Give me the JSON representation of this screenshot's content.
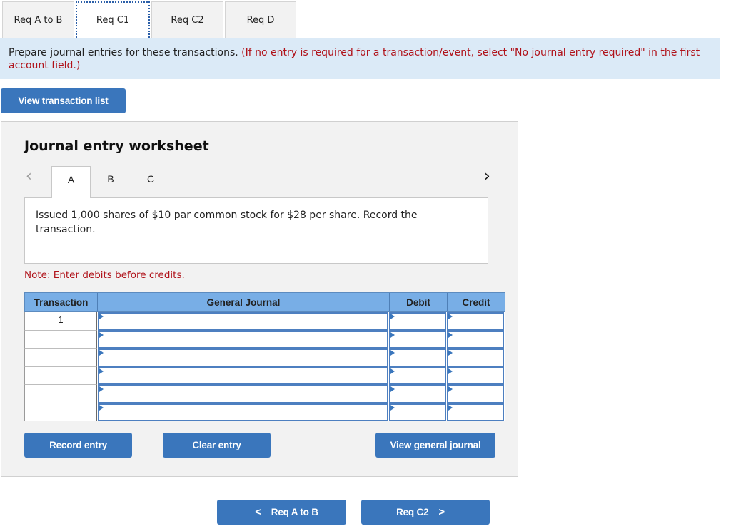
{
  "req_tabs": [
    {
      "label": "Req A to B",
      "active": false
    },
    {
      "label": "Req C1",
      "active": true
    },
    {
      "label": "Req C2",
      "active": false
    },
    {
      "label": "Req D",
      "active": false
    }
  ],
  "instruction": {
    "main": "Prepare journal entries for these transactions. ",
    "note": "(If no entry is required for a transaction/event, select \"No journal entry required\" in the first account field.)"
  },
  "view_transaction_list_label": "View transaction list",
  "worksheet": {
    "title": "Journal entry worksheet",
    "prev_icon": "chevron-left-icon",
    "next_icon": "chevron-right-icon",
    "sub_tabs": [
      {
        "label": "A",
        "active": true
      },
      {
        "label": "B",
        "active": false
      },
      {
        "label": "C",
        "active": false
      }
    ],
    "description": "Issued 1,000 shares of $10 par common stock for $28 per share. Record the transaction.",
    "note": "Note: Enter debits before credits.",
    "table": {
      "headers": {
        "transaction": "Transaction",
        "general_journal": "General Journal",
        "debit": "Debit",
        "credit": "Credit"
      },
      "rows": [
        {
          "transaction": "1",
          "account": "",
          "debit": "",
          "credit": ""
        },
        {
          "transaction": "",
          "account": "",
          "debit": "",
          "credit": ""
        },
        {
          "transaction": "",
          "account": "",
          "debit": "",
          "credit": ""
        },
        {
          "transaction": "",
          "account": "",
          "debit": "",
          "credit": ""
        },
        {
          "transaction": "",
          "account": "",
          "debit": "",
          "credit": ""
        },
        {
          "transaction": "",
          "account": "",
          "debit": "",
          "credit": ""
        }
      ]
    },
    "buttons": {
      "record": "Record entry",
      "clear": "Clear entry",
      "view_general_journal": "View general journal"
    }
  },
  "nav": {
    "prev_label": "Req A to B",
    "prev_arrow": "<",
    "next_label": "Req C2",
    "next_arrow": ">"
  },
  "colors": {
    "accent_blue": "#3a76bc",
    "header_blue": "#78aee6",
    "instruction_bg": "#dbeaf7",
    "alert_red": "#b0121a"
  }
}
